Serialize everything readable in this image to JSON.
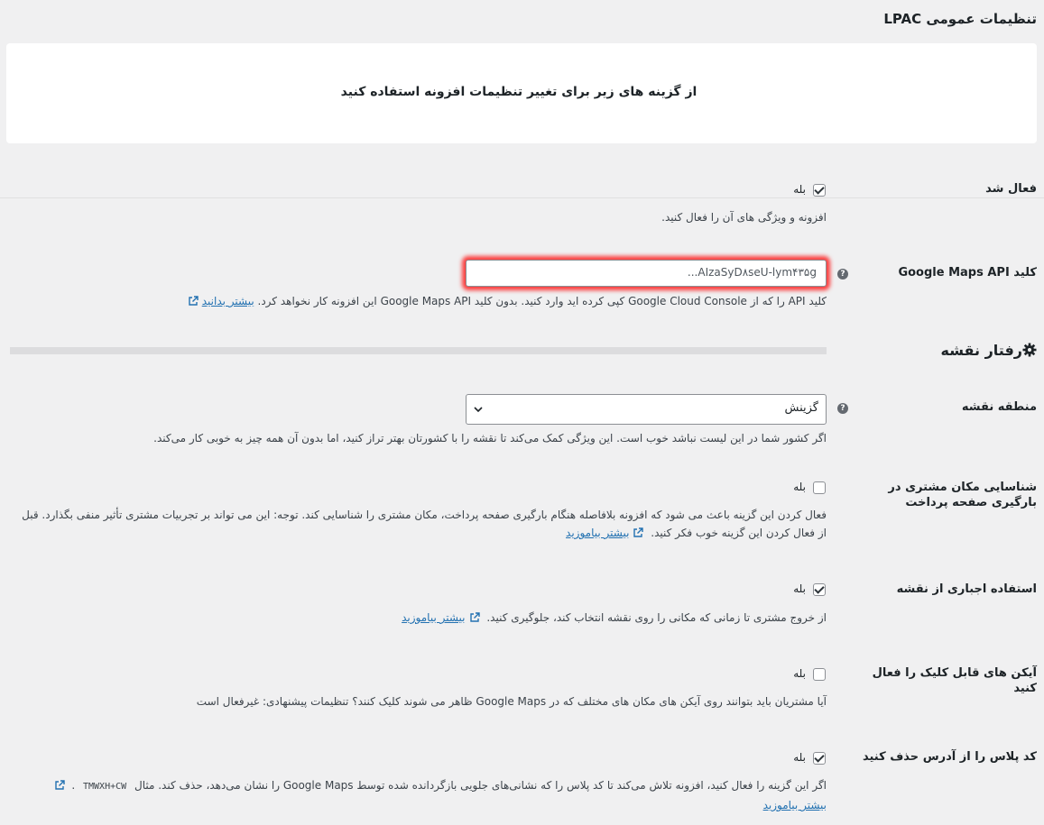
{
  "page_title": "تنظیمات عمومی LPAC",
  "notice": "از گزینه های زیر برای تغییر تنظیمات افزونه استفاده کنید",
  "yes_label": "بله",
  "settings": {
    "enabled": {
      "label": "فعال شد",
      "checked": true,
      "desc": "افزونه و ویژگی های آن را فعال کنید."
    },
    "api_key": {
      "label": "کلید Google Maps API",
      "value": "...AIzaSyD۸seU-lym۴۳۵g",
      "desc": "کلید API را که از Google Cloud Console کپی کرده اید وارد کنید. بدون کلید Google Maps API این افزونه کار نخواهد کرد.",
      "link": "بیشتر بدانید"
    },
    "map_region": {
      "label": "منطقه نقشه",
      "selected": "گزینش",
      "desc": "اگر کشور شما در این لیست نباشد خوب است. این ویژگی کمک می‌کند تا نقشه را با کشورتان بهتر تراز کنید، اما بدون آن همه چیز به خوبی کار می‌کند."
    },
    "detect_location": {
      "label": "شناسایی مکان مشتری در بارگیری صفحه پرداخت",
      "checked": false,
      "desc": "فعال کردن این گزینه باعث می شود که افزونه بلافاصله هنگام بارگیری صفحه پرداخت، مکان مشتری را شناسایی کند. توجه: این می تواند بر تجربیات مشتری تأثیر منفی بگذارد. قبل از فعال کردن این گزینه خوب فکر کنید.",
      "link": "بیشتر بیاموزید"
    },
    "force_map": {
      "label": "استفاده اجباری از نقشه",
      "checked": true,
      "desc": "از خروج مشتری تا زمانی که مکانی را روی نقشه انتخاب کند، جلوگیری کنید.",
      "link": "بیشتر بیاموزید"
    },
    "clickable_icons": {
      "label": "آیکن های قابل کلیک را فعال کنید",
      "checked": false,
      "desc": "آیا مشتریان باید بتوانند روی آیکن های مکان های مختلف که در Google Maps ظاهر می شوند کلیک کنند؟ تنظیمات پیشنهادی: غیرفعال است"
    },
    "remove_plus_code": {
      "label": "کد پلاس را از آدرس حذف کنید",
      "checked": true,
      "desc": "اگر این گزینه را فعال کنید، افزونه تلاش می‌کند تا کد پلاس را که نشانی‌های جلویی بازگردانده شده توسط Google Maps را نشان می‌دهد، حذف کند. مثال",
      "example": "TMWXH+CW",
      "link": "بیشتر بیاموزید"
    }
  },
  "section_map_behavior": "رفتار نقشه",
  "colors": {
    "link": "#2271b1",
    "highlight": "#ff0000"
  }
}
